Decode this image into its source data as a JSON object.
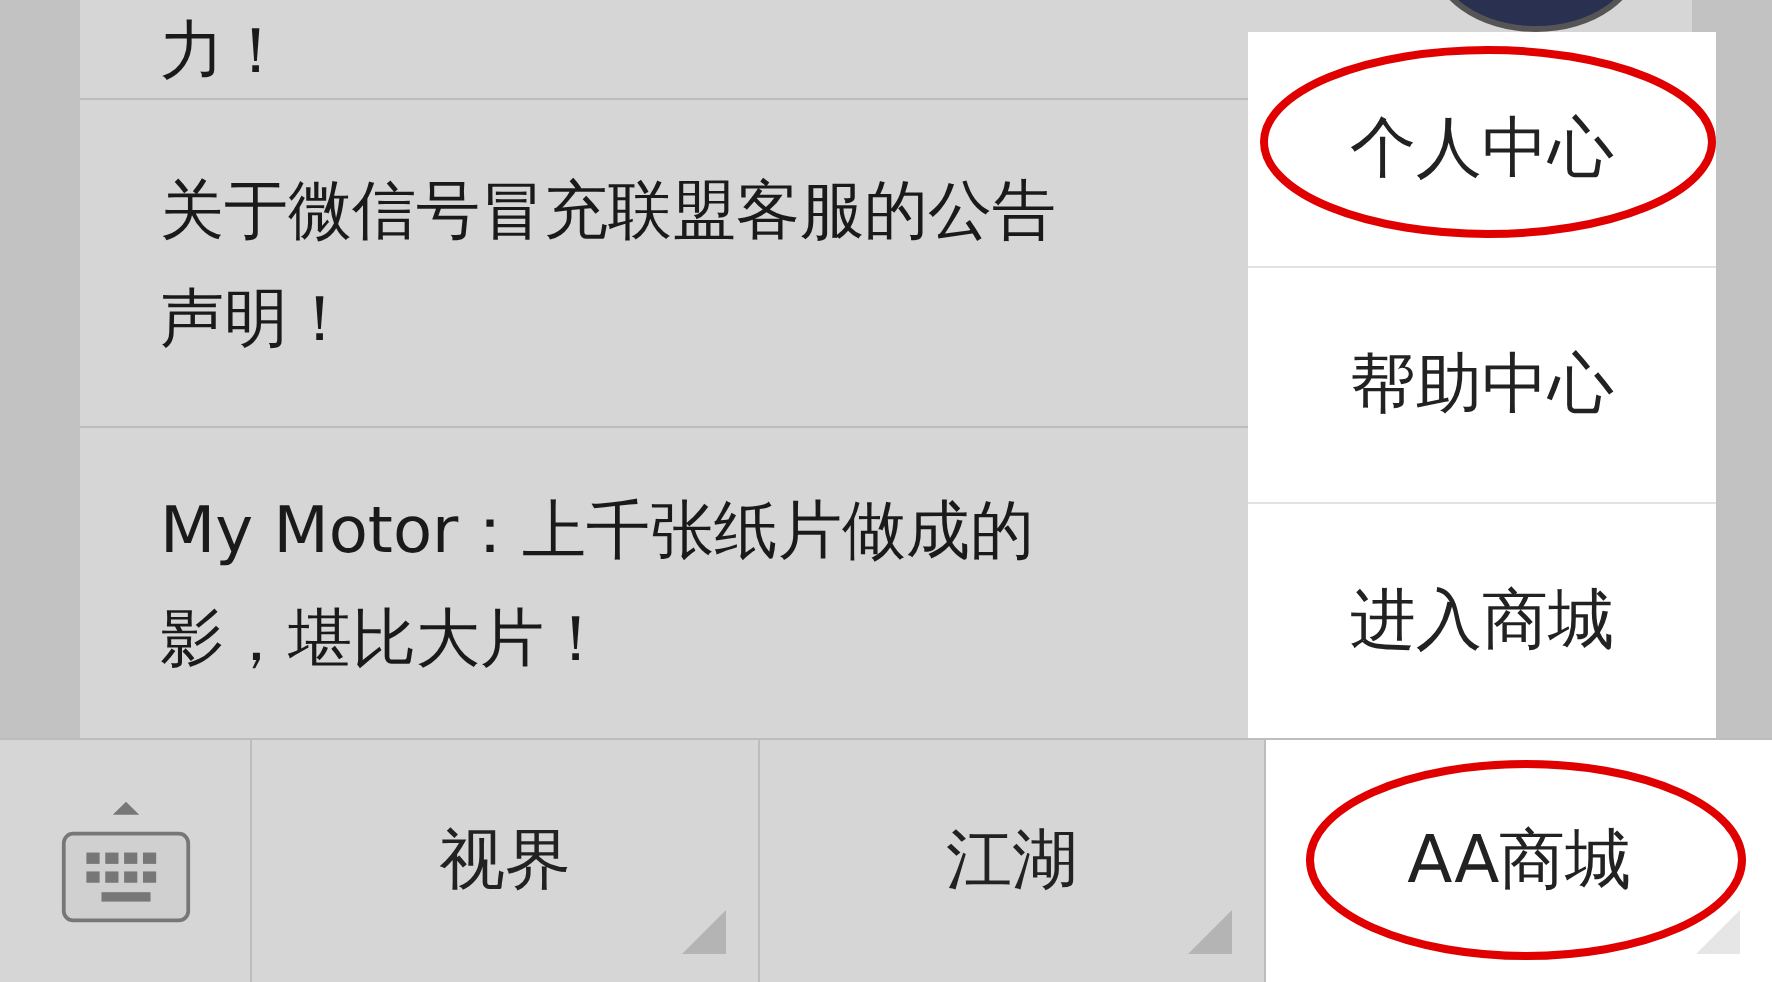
{
  "articles": [
    {
      "lines": [
        "力！"
      ]
    },
    {
      "lines": [
        "关于微信号冒充联盟客服的公告",
        "声明！"
      ]
    },
    {
      "lines": [
        "My Motor：上千张纸片做成的",
        "影，堪比大片！"
      ]
    }
  ],
  "popup_menu": {
    "items": [
      {
        "label": "个人中心",
        "circled": true
      },
      {
        "label": "帮助中心",
        "circled": false
      },
      {
        "label": "进入商城",
        "circled": false
      }
    ]
  },
  "bottom_menu": {
    "items": [
      {
        "label": "视界",
        "selected": false,
        "circled": false
      },
      {
        "label": "江湖",
        "selected": false,
        "circled": false
      },
      {
        "label": "AA商城",
        "selected": true,
        "circled": true
      }
    ]
  }
}
